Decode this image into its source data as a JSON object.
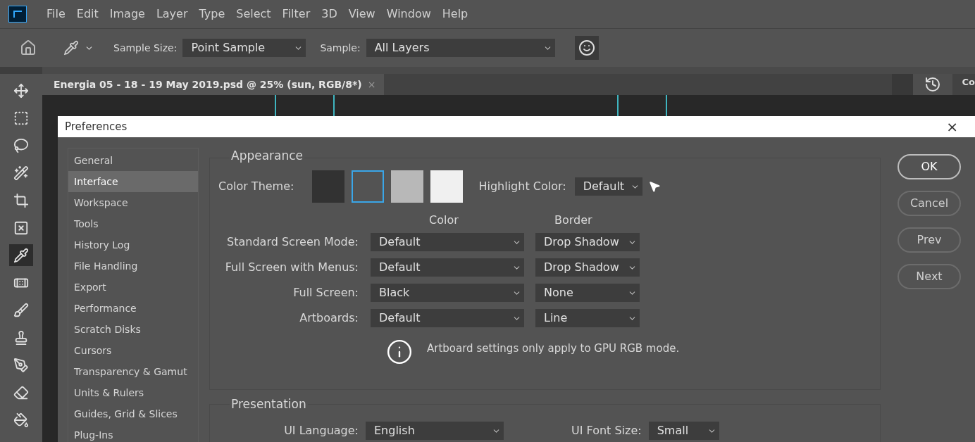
{
  "menu_bar": {
    "items": [
      "File",
      "Edit",
      "Image",
      "Layer",
      "Type",
      "Select",
      "Filter",
      "3D",
      "View",
      "Window",
      "Help"
    ]
  },
  "options_bar": {
    "sample_size_label": "Sample Size:",
    "sample_size": "Point Sample",
    "sample_label": "Sample:",
    "sample": "All Layers"
  },
  "document_tab": {
    "title": "Energia 05 - 18 - 19 May 2019.psd @ 25% (sun, RGB/8*)",
    "close": "×"
  },
  "right_panel": {
    "tab": "Co"
  },
  "tools": [
    {
      "kind": "move",
      "selected": false
    },
    {
      "kind": "marquee",
      "selected": false
    },
    {
      "kind": "lasso",
      "selected": false
    },
    {
      "kind": "wand",
      "selected": false
    },
    {
      "kind": "crop",
      "selected": false
    },
    {
      "kind": "frame",
      "selected": false
    },
    {
      "kind": "eyedropper",
      "selected": true
    },
    {
      "kind": "healing",
      "selected": false
    },
    {
      "kind": "brush",
      "selected": false
    },
    {
      "kind": "stamp",
      "selected": false
    },
    {
      "kind": "history",
      "selected": false
    },
    {
      "kind": "eraser",
      "selected": false
    },
    {
      "kind": "bucket",
      "selected": false
    }
  ],
  "dialog": {
    "title": "Preferences",
    "close": "×",
    "categories": [
      {
        "label": "General",
        "selected": false
      },
      {
        "label": "Interface",
        "selected": true
      },
      {
        "label": "Workspace",
        "selected": false
      },
      {
        "label": "Tools",
        "selected": false
      },
      {
        "label": "History Log",
        "selected": false
      },
      {
        "label": "File Handling",
        "selected": false
      },
      {
        "label": "Export",
        "selected": false
      },
      {
        "label": "Performance",
        "selected": false
      },
      {
        "label": "Scratch Disks",
        "selected": false
      },
      {
        "label": "Cursors",
        "selected": false
      },
      {
        "label": "Transparency & Gamut",
        "selected": false
      },
      {
        "label": "Units & Rulers",
        "selected": false
      },
      {
        "label": "Guides, Grid & Slices",
        "selected": false
      },
      {
        "label": "Plug-Ins",
        "selected": false
      }
    ],
    "appearance": {
      "title": "Appearance",
      "color_theme_label": "Color Theme:",
      "themes": [
        {
          "color": "#323232",
          "selected": false
        },
        {
          "color": "#535353",
          "selected": true
        },
        {
          "color": "#b8b8b8",
          "selected": false
        },
        {
          "color": "#f0f0f0",
          "selected": false
        }
      ],
      "highlight_label": "Highlight Color:",
      "highlight_value": "Default",
      "column_headers": [
        "Color",
        "Border"
      ],
      "modes": [
        {
          "label": "Standard Screen Mode:",
          "color_value": "Default",
          "border": "Drop Shadow"
        },
        {
          "label": "Full Screen with Menus:",
          "color_value": "Default",
          "border": "Drop Shadow"
        },
        {
          "label": "Full Screen:",
          "color_value": "Black",
          "border": "None"
        },
        {
          "label": "Artboards:",
          "color_value": "Default",
          "border": "Line"
        }
      ],
      "note": "Artboard settings only apply to GPU RGB mode."
    },
    "presentation": {
      "title": "Presentation",
      "ui_language_label": "UI Language:",
      "ui_language": "English",
      "ui_font_size_label": "UI Font Size:",
      "ui_font_size": "Small"
    },
    "buttons": [
      {
        "label": "OK",
        "primary": true
      },
      {
        "label": "Cancel",
        "primary": false
      },
      {
        "label": "Prev",
        "primary": false
      },
      {
        "label": "Next",
        "primary": false
      }
    ]
  }
}
